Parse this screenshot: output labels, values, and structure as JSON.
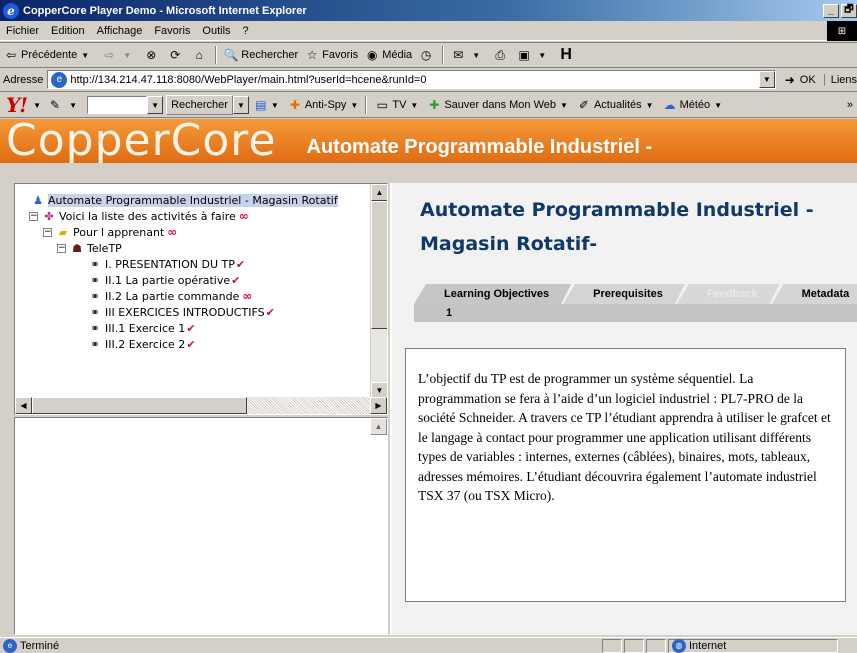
{
  "window": {
    "title": "CopperCore Player Demo - Microsoft Internet Explorer",
    "min_glyph": "_",
    "max_glyph": "🗗",
    "close_glyph": "✕"
  },
  "menu": [
    "Fichier",
    "Edition",
    "Affichage",
    "Favoris",
    "Outils",
    "?"
  ],
  "toolbar": {
    "back": "Précédente",
    "search": "Rechercher",
    "favorites": "Favoris",
    "media": "Média"
  },
  "address": {
    "label": "Adresse",
    "url": "http://134.214.47.118:8080/WebPlayer/main.html?userId=hcene&runId=0",
    "go": "OK",
    "links": "Liens"
  },
  "yahoo": {
    "logo": "Y!",
    "search": "Rechercher",
    "antispy": "Anti-Spy",
    "tv": "TV",
    "save": "Sauver dans Mon Web",
    "news": "Actualités",
    "weather": "Météo",
    "more": "»"
  },
  "banner": {
    "brand": "CopperCore",
    "title": "Automate Programmable Industriel -"
  },
  "tree": {
    "root": "Automate Programmable Industriel - Magasin Rotatif",
    "activities": "Voici la liste des activités à faire",
    "learner": "Pour l apprenant",
    "teletp": "TeleTP",
    "items": [
      {
        "label": "I. PRESENTATION DU TP",
        "mark": "✔"
      },
      {
        "label": "II.1 La partie opérative",
        "mark": "✔"
      },
      {
        "label": "II.2 La partie commande",
        "mark": "∞"
      },
      {
        "label": "III EXERCICES INTRODUCTIFS",
        "mark": "✔"
      },
      {
        "label": "III.1 Exercice 1",
        "mark": "✔"
      },
      {
        "label": "III.2 Exercice 2",
        "mark": "✔"
      }
    ],
    "infinity": "∞"
  },
  "content": {
    "title": "Automate Programmable Industriel - Magasin Rotatif-",
    "tabs": [
      "Learning Objectives",
      "Prerequisites",
      "Feedback",
      "Metadata"
    ],
    "tab_row_value": "1",
    "paragraph": "L’objectif du TP est de programmer un système séquentiel. La programmation se fera à l’aide d’un logiciel industriel : PL7-PRO de la société Schneider. A travers ce TP l’étudiant apprendra à utiliser le grafcet et le langage à contact pour programmer une application utilisant différents types de variables : internes, externes (câblées), binaires, mots, tableaux, adresses mémoires. L’étudiant découvrira également l’automate industriel TSX 37 (ou TSX Micro)."
  },
  "status": {
    "left": "Terminé",
    "zone": "Internet"
  },
  "colors": {
    "banner": "#e87722",
    "title_blue": "#103868",
    "infinity_red": "#e0003a",
    "check_magenta": "#c01050"
  }
}
